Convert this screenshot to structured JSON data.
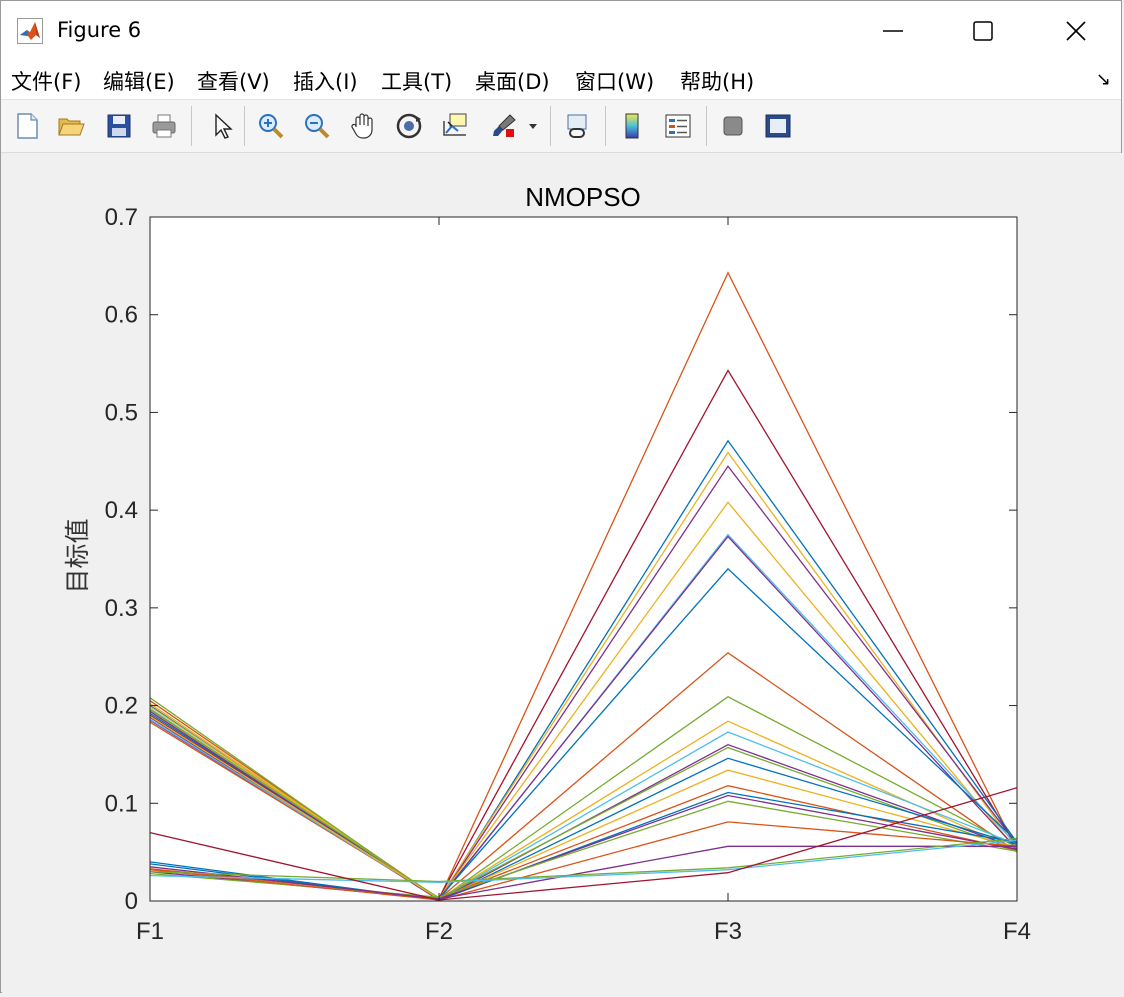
{
  "window": {
    "title": "Figure 6"
  },
  "menu": [
    "文件(F)",
    "编辑(E)",
    "查看(V)",
    "插入(I)",
    "工具(T)",
    "桌面(D)",
    "窗口(W)",
    "帮助(H)"
  ],
  "toolbar_icons": [
    "new-figure-icon",
    "open-file-icon",
    "save-icon",
    "print-icon",
    "pointer-icon",
    "zoom-in-icon",
    "zoom-out-icon",
    "pan-icon",
    "rotate-3d-icon",
    "data-cursor-icon",
    "brush-icon",
    "link-plot-icon",
    "colorbar-icon",
    "legend-icon",
    "hide-plot-tools-icon",
    "show-plot-tools-icon"
  ],
  "chart_data": {
    "type": "line",
    "title": "NMOPSO",
    "xlabel": "",
    "ylabel": "目标值",
    "categories": [
      "F1",
      "F2",
      "F3",
      "F4"
    ],
    "ylim": [
      0,
      0.7
    ],
    "yticks": [
      0,
      0.1,
      0.2,
      0.3,
      0.4,
      0.5,
      0.6,
      0.7
    ],
    "grid": false,
    "series": [
      {
        "color": "#D95319",
        "values": [
          0.205,
          0.002,
          0.643,
          0.052
        ]
      },
      {
        "color": "#A2142F",
        "values": [
          0.19,
          0.003,
          0.543,
          0.055
        ]
      },
      {
        "color": "#0072BD",
        "values": [
          0.2,
          0.001,
          0.471,
          0.06
        ]
      },
      {
        "color": "#EDB120",
        "values": [
          0.195,
          0.002,
          0.459,
          0.054
        ]
      },
      {
        "color": "#7E2F8E",
        "values": [
          0.188,
          0.001,
          0.445,
          0.058
        ]
      },
      {
        "color": "#EDB120",
        "values": [
          0.202,
          0.002,
          0.408,
          0.052
        ]
      },
      {
        "color": "#4DBEEE",
        "values": [
          0.197,
          0.001,
          0.375,
          0.057
        ]
      },
      {
        "color": "#7E2F8E",
        "values": [
          0.185,
          0.002,
          0.373,
          0.053
        ]
      },
      {
        "color": "#0072BD",
        "values": [
          0.192,
          0.003,
          0.34,
          0.061
        ]
      },
      {
        "color": "#D95319",
        "values": [
          0.183,
          0.002,
          0.254,
          0.05
        ]
      },
      {
        "color": "#77AC30",
        "values": [
          0.208,
          0.001,
          0.209,
          0.055
        ]
      },
      {
        "color": "#EDB120",
        "values": [
          0.199,
          0.002,
          0.184,
          0.052
        ]
      },
      {
        "color": "#4DBEEE",
        "values": [
          0.186,
          0.002,
          0.173,
          0.058
        ]
      },
      {
        "color": "#7E2F8E",
        "values": [
          0.194,
          0.001,
          0.16,
          0.054
        ]
      },
      {
        "color": "#77AC30",
        "values": [
          0.196,
          0.003,
          0.157,
          0.052
        ]
      },
      {
        "color": "#0072BD",
        "values": [
          0.04,
          0.001,
          0.146,
          0.058
        ]
      },
      {
        "color": "#EDB120",
        "values": [
          0.189,
          0.002,
          0.134,
          0.055
        ]
      },
      {
        "color": "#D95319",
        "values": [
          0.033,
          0.003,
          0.118,
          0.052
        ]
      },
      {
        "color": "#0072BD",
        "values": [
          0.038,
          0.001,
          0.111,
          0.06
        ]
      },
      {
        "color": "#7E2F8E",
        "values": [
          0.03,
          0.002,
          0.108,
          0.053
        ]
      },
      {
        "color": "#77AC30",
        "values": [
          0.028,
          0.004,
          0.102,
          0.051
        ]
      },
      {
        "color": "#D95319",
        "values": [
          0.032,
          0.001,
          0.081,
          0.056
        ]
      },
      {
        "color": "#7E2F8E",
        "values": [
          0.035,
          0.002,
          0.056,
          0.056
        ]
      },
      {
        "color": "#77AC30",
        "values": [
          0.03,
          0.02,
          0.034,
          0.064
        ]
      },
      {
        "color": "#4DBEEE",
        "values": [
          0.026,
          0.019,
          0.032,
          0.062
        ]
      },
      {
        "color": "#A2142F",
        "values": [
          0.07,
          0.001,
          0.029,
          0.116
        ]
      }
    ]
  }
}
